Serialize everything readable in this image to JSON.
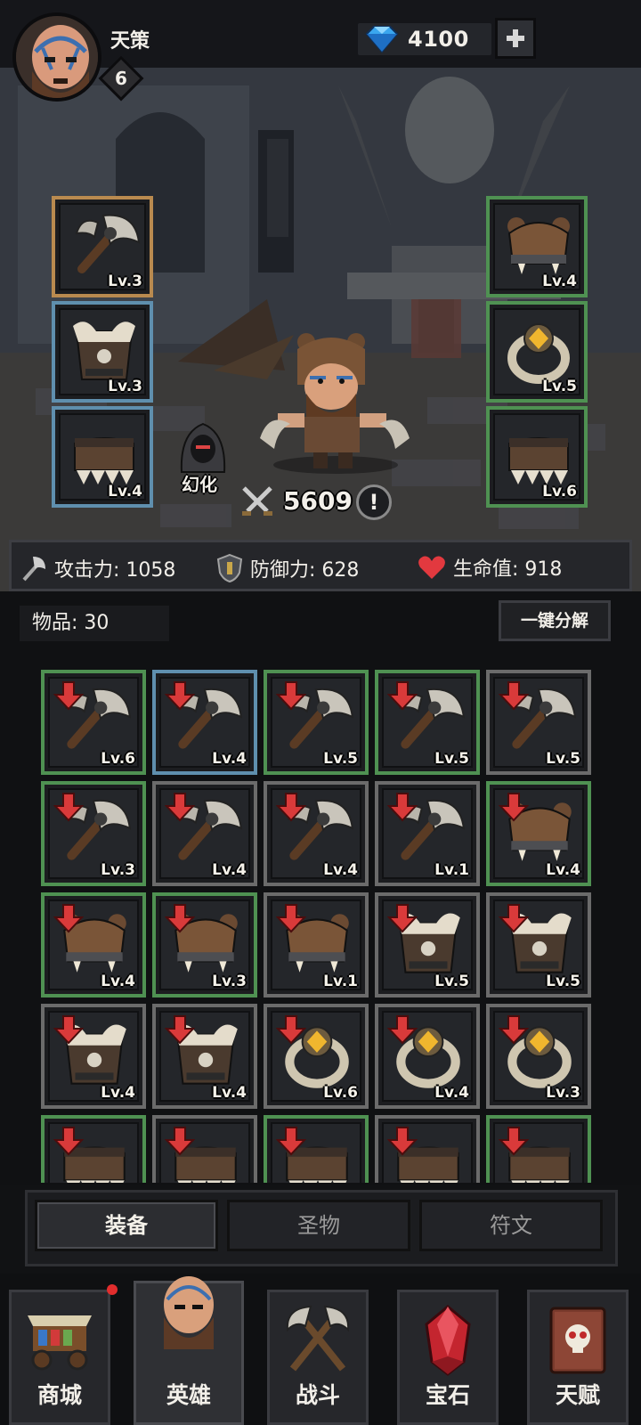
{
  "player": {
    "name": "天策",
    "level": "6"
  },
  "currency": {
    "gems": "4100",
    "gem_icon": "diamond-gem-icon",
    "add_icon": "plus-icon"
  },
  "hero": {
    "power": "5609",
    "transform_label": "幻化",
    "info_symbol": "!",
    "equipped_left": [
      {
        "item": "axe",
        "level": "Lv.3",
        "quality": "gold"
      },
      {
        "item": "fur-armor",
        "level": "Lv.3",
        "quality": "blue"
      },
      {
        "item": "fur-boots",
        "level": "Lv.4",
        "quality": "blue"
      }
    ],
    "equipped_right": [
      {
        "item": "bear-helm",
        "level": "Lv.4",
        "quality": "green"
      },
      {
        "item": "gold-ring",
        "level": "Lv.5",
        "quality": "green"
      },
      {
        "item": "fur-boots",
        "level": "Lv.6",
        "quality": "green"
      }
    ]
  },
  "stats": {
    "attack": "攻击力: 1058",
    "defense": "防御力: 628",
    "hp": "生命值: 918"
  },
  "inventory": {
    "count_label": "物品: 30",
    "disassemble_label": "一键分解",
    "items": [
      {
        "item": "axe",
        "level": "Lv.6",
        "quality": "green"
      },
      {
        "item": "axe",
        "level": "Lv.4",
        "quality": "blue"
      },
      {
        "item": "axe",
        "level": "Lv.5",
        "quality": "green"
      },
      {
        "item": "axe",
        "level": "Lv.5",
        "quality": "green"
      },
      {
        "item": "axe",
        "level": "Lv.5",
        "quality": "grey"
      },
      {
        "item": "axe",
        "level": "Lv.3",
        "quality": "green"
      },
      {
        "item": "axe",
        "level": "Lv.4",
        "quality": "grey"
      },
      {
        "item": "axe",
        "level": "Lv.4",
        "quality": "grey"
      },
      {
        "item": "axe",
        "level": "Lv.1",
        "quality": "grey"
      },
      {
        "item": "bear-helm",
        "level": "Lv.4",
        "quality": "green"
      },
      {
        "item": "bear-helm",
        "level": "Lv.4",
        "quality": "green"
      },
      {
        "item": "bear-helm",
        "level": "Lv.3",
        "quality": "green"
      },
      {
        "item": "bear-helm",
        "level": "Lv.1",
        "quality": "grey"
      },
      {
        "item": "fur-armor",
        "level": "Lv.5",
        "quality": "grey"
      },
      {
        "item": "fur-armor",
        "level": "Lv.5",
        "quality": "grey"
      },
      {
        "item": "fur-armor",
        "level": "Lv.4",
        "quality": "grey"
      },
      {
        "item": "fur-armor",
        "level": "Lv.4",
        "quality": "grey"
      },
      {
        "item": "gold-ring",
        "level": "Lv.6",
        "quality": "grey"
      },
      {
        "item": "gold-ring",
        "level": "Lv.4",
        "quality": "grey"
      },
      {
        "item": "gold-ring",
        "level": "Lv.3",
        "quality": "grey"
      },
      {
        "item": "fur-boots",
        "level": "",
        "quality": "green"
      },
      {
        "item": "fur-boots",
        "level": "",
        "quality": "grey"
      },
      {
        "item": "fur-boots",
        "level": "",
        "quality": "green"
      },
      {
        "item": "fur-boots",
        "level": "",
        "quality": "grey"
      },
      {
        "item": "fur-boots",
        "level": "",
        "quality": "green"
      }
    ]
  },
  "tabs": [
    {
      "label": "装备",
      "active": true
    },
    {
      "label": "圣物",
      "active": false
    },
    {
      "label": "符文",
      "active": false
    }
  ],
  "nav": [
    {
      "label": "商城",
      "icon": "market-cart-icon",
      "badge": true
    },
    {
      "label": "英雄",
      "icon": "hero-portrait-icon",
      "active": true
    },
    {
      "label": "战斗",
      "icon": "crossed-axes-icon"
    },
    {
      "label": "宝石",
      "icon": "red-gem-icon"
    },
    {
      "label": "天赋",
      "icon": "skull-book-icon"
    }
  ],
  "colors": {
    "quality_gold": "#b98a4f",
    "quality_blue": "#5f8fae",
    "quality_green": "#4f9152",
    "quality_grey": "#6b6b6b",
    "down_arrow": "#d93a3a",
    "notification": "#e22d2d"
  }
}
